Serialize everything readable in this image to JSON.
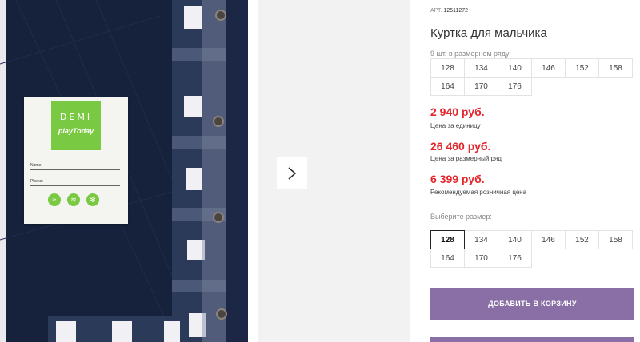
{
  "photo": {
    "label_title": "DEMI",
    "label_brand": "playToday",
    "field_name": "Name:",
    "field_phone": "Phone:",
    "icons": [
      "snowflake-icon",
      "wind-icon",
      "water-icon"
    ]
  },
  "gallery": {
    "next_icon": "chevron-right-icon"
  },
  "product": {
    "art_label": "АРТ.",
    "art_number": "12511272",
    "title": "Куртка для мальчика",
    "pack_note": "9 шт. в размерном ряду",
    "pack_sizes": [
      [
        "128",
        "134",
        "140",
        "146",
        "152",
        "158"
      ],
      [
        "164",
        "170",
        "176"
      ]
    ],
    "price_unit": "2 940 руб.",
    "price_unit_note": "Цена за единицу",
    "price_pack": "26 460 руб.",
    "price_pack_note": "Цена за размерный ряд",
    "price_retail": "6 399 руб.",
    "price_retail_note": "Рекомендуемая розничная цена",
    "choose_size_label": "Выберите размер:",
    "sizes": [
      [
        "128",
        "134",
        "140",
        "146",
        "152",
        "158"
      ],
      [
        "164",
        "170",
        "176"
      ]
    ],
    "selected_size": "128",
    "cart_button": "ДОБАВИТЬ В КОРЗИНУ",
    "accent_color": "#8a6ea6",
    "price_color": "#e3262b"
  }
}
